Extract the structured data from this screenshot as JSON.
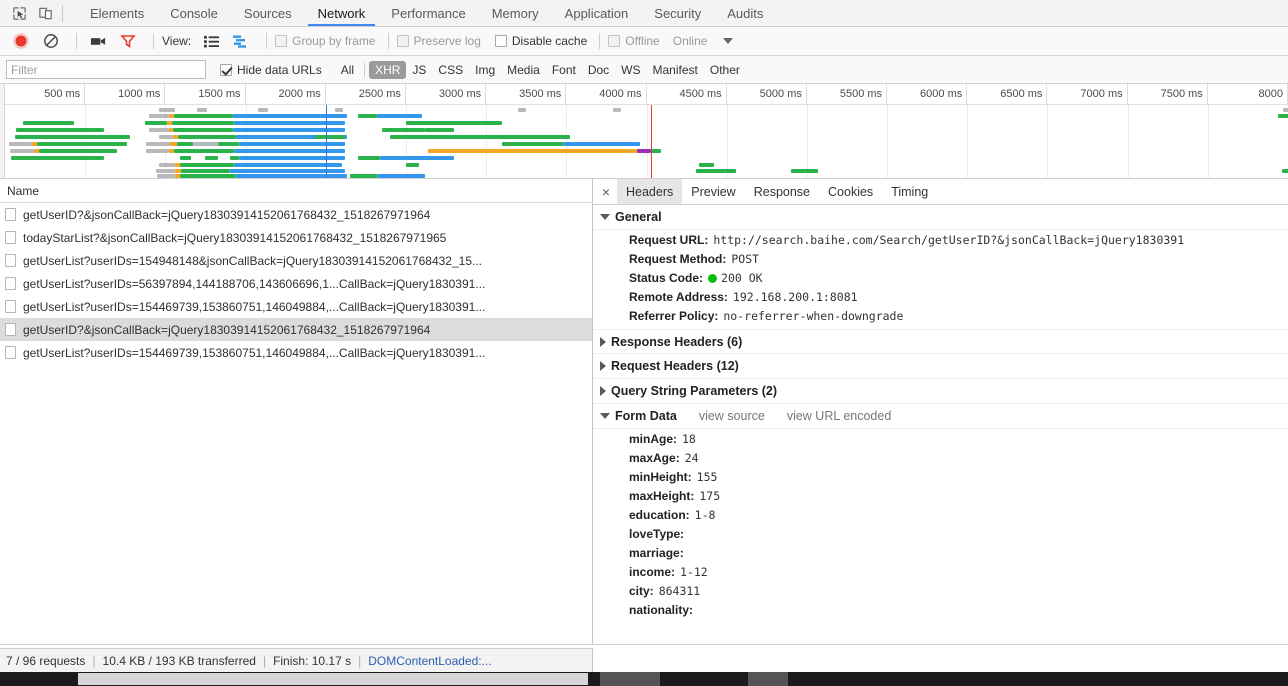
{
  "devtools": {
    "left_icons": [
      {
        "name": "inspect-element-icon",
        "glyph": "inspect"
      },
      {
        "name": "device-toolbar-icon",
        "glyph": "device"
      }
    ],
    "tabs": [
      {
        "label": "Elements",
        "selected": false
      },
      {
        "label": "Console",
        "selected": false
      },
      {
        "label": "Sources",
        "selected": false
      },
      {
        "label": "Network",
        "selected": true
      },
      {
        "label": "Performance",
        "selected": false
      },
      {
        "label": "Memory",
        "selected": false
      },
      {
        "label": "Application",
        "selected": false
      },
      {
        "label": "Security",
        "selected": false
      },
      {
        "label": "Audits",
        "selected": false
      }
    ],
    "accent_color": "#4285f4"
  },
  "toolbar": {
    "record_button": {
      "name": "record-button",
      "active": true,
      "color": "#e8392e"
    },
    "clear_button": {
      "name": "clear-button"
    },
    "capture_screenshots_button": {
      "name": "camera-icon"
    },
    "filter_button": {
      "name": "funnel-icon",
      "active": true,
      "color": "#e8392e"
    },
    "view_label": "View:",
    "view_list_button": {
      "name": "view-list-icon"
    },
    "view_waterfall_button": {
      "name": "view-waterfall-icon"
    },
    "group_by_frame": {
      "label": "Group by frame",
      "checked": false,
      "disabled": true
    },
    "preserve_log": {
      "label": "Preserve log",
      "checked": false,
      "disabled": true
    },
    "disable_cache": {
      "label": "Disable cache",
      "checked": false,
      "disabled": false
    },
    "offline": {
      "label": "Offline",
      "checked": false,
      "disabled": true
    },
    "online_label": "Online",
    "throttling_caret": {
      "name": "chevron-down-icon"
    }
  },
  "filterbar": {
    "filter_placeholder": "Filter",
    "filter_value": "",
    "hide_data_urls": {
      "label": "Hide data URLs",
      "checked": true
    },
    "types": [
      {
        "label": "All",
        "active": false
      },
      {
        "label": "XHR",
        "active": true
      },
      {
        "label": "JS",
        "active": false
      },
      {
        "label": "CSS",
        "active": false
      },
      {
        "label": "Img",
        "active": false
      },
      {
        "label": "Media",
        "active": false
      },
      {
        "label": "Font",
        "active": false
      },
      {
        "label": "Doc",
        "active": false
      },
      {
        "label": "WS",
        "active": false
      },
      {
        "label": "Manifest",
        "active": false
      },
      {
        "label": "Other",
        "active": false
      }
    ],
    "active_pill_color": "#9a9a9a"
  },
  "overview": {
    "ticks": [
      "500 ms",
      "1000 ms",
      "1500 ms",
      "2000 ms",
      "2500 ms",
      "3000 ms",
      "3500 ms",
      "4000 ms",
      "4500 ms",
      "5000 ms",
      "5500 ms",
      "6000 ms",
      "6500 ms",
      "7000 ms",
      "7500 ms",
      "8000"
    ],
    "colors": {
      "receiving_green": "#2bb34b",
      "waiting_blue": "#3398ec",
      "queue_grey": "#b9b9b9",
      "stalled_orange": "#f5a623",
      "other_purple": "#9b30b5",
      "dom_content_loaded": "#3b74d8",
      "load_event": "#e8392e"
    },
    "dom_content_loaded_ms": 2000,
    "load_event_ms": 4030
  },
  "requests": {
    "column_header": "Name",
    "rows": [
      {
        "name": "getUserID?&jsonCallBack=jQuery18303914152061768432_1518267971964",
        "selected": false
      },
      {
        "name": "todayStarList?&jsonCallBack=jQuery18303914152061768432_1518267971965",
        "selected": false
      },
      {
        "name": "getUserList?userIDs=154948148&jsonCallBack=jQuery18303914152061768432_15...",
        "selected": false
      },
      {
        "name": "getUserList?userIDs=56397894,144188706,143606696,1...CallBack=jQuery1830391...",
        "selected": false
      },
      {
        "name": "getUserList?userIDs=154469739,153860751,146049884,...CallBack=jQuery1830391...",
        "selected": false
      },
      {
        "name": "getUserID?&jsonCallBack=jQuery18303914152061768432_1518267971964",
        "selected": true
      },
      {
        "name": "getUserList?userIDs=154469739,153860751,146049884,...CallBack=jQuery1830391...",
        "selected": false
      }
    ]
  },
  "detail": {
    "close_label": "×",
    "tabs": [
      {
        "label": "Headers",
        "selected": true
      },
      {
        "label": "Preview",
        "selected": false
      },
      {
        "label": "Response",
        "selected": false
      },
      {
        "label": "Cookies",
        "selected": false
      },
      {
        "label": "Timing",
        "selected": false
      }
    ],
    "general": {
      "title": "General",
      "expanded": true,
      "items": [
        {
          "key": "Request URL:",
          "value": "http://search.baihe.com/Search/getUserID?&jsonCallBack=jQuery1830391"
        },
        {
          "key": "Request Method:",
          "value": "POST"
        },
        {
          "key": "Status Code:",
          "value": "200  OK",
          "status_dot": true
        },
        {
          "key": "Remote Address:",
          "value": "192.168.200.1:8081"
        },
        {
          "key": "Referrer Policy:",
          "value": "no-referrer-when-downgrade"
        }
      ]
    },
    "collapsed_sections": [
      {
        "title": "Response Headers (6)"
      },
      {
        "title": "Request Headers (12)"
      },
      {
        "title": "Query String Parameters (2)"
      }
    ],
    "form_data": {
      "title": "Form Data",
      "expanded": true,
      "view_source_label": "view source",
      "view_url_encoded_label": "view URL encoded",
      "items": [
        {
          "key": "minAge:",
          "value": "18"
        },
        {
          "key": "maxAge:",
          "value": "24"
        },
        {
          "key": "minHeight:",
          "value": "155"
        },
        {
          "key": "maxHeight:",
          "value": "175"
        },
        {
          "key": "education:",
          "value": "1-8"
        },
        {
          "key": "loveType:",
          "value": ""
        },
        {
          "key": "marriage:",
          "value": ""
        },
        {
          "key": "income:",
          "value": "1-12"
        },
        {
          "key": "city:",
          "value": "864311"
        },
        {
          "key": "nationality:",
          "value": ""
        }
      ]
    }
  },
  "statusbar": {
    "requests": "7 / 96 requests",
    "transferred": "10.4 KB / 193 KB transferred",
    "finish": "Finish: 10.17 s",
    "dom_content_loaded": "DOMContentLoaded:...",
    "separator": "|"
  }
}
